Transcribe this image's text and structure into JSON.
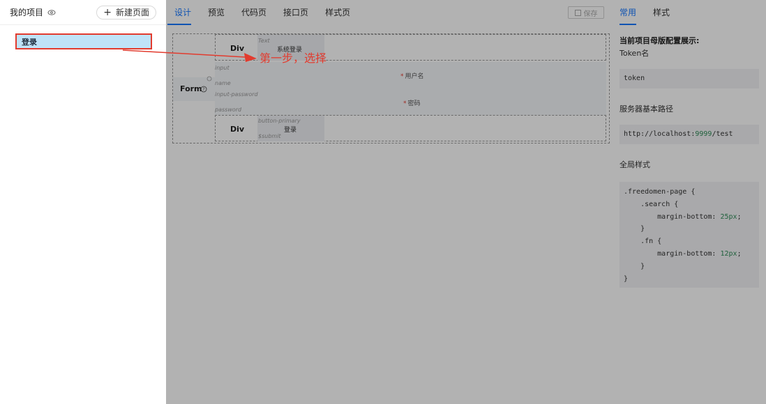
{
  "sidebar": {
    "title": "我的项目",
    "new_page_label": "新建页面",
    "pages": [
      {
        "label": "登录"
      }
    ]
  },
  "main": {
    "tabs": [
      {
        "label": "设计",
        "active": true
      },
      {
        "label": "预览"
      },
      {
        "label": "代码页"
      },
      {
        "label": "接口页"
      },
      {
        "label": "样式页"
      }
    ],
    "save_label": "保存",
    "canvas": {
      "div1_label": "Div",
      "text_hint": "Text",
      "title_text": "系统登录",
      "form_label": "Form",
      "input_hint": "input",
      "name_hint": "name",
      "username_label": "用户名",
      "password_hint": "input-password",
      "password_name_hint": "password",
      "password_label": "密码",
      "div2_label": "Div",
      "button_hint": "button-primary",
      "button_text": "登录",
      "submit_hint": "$submit"
    }
  },
  "right_panel": {
    "tabs": [
      {
        "label": "常用",
        "active": true
      },
      {
        "label": "样式"
      }
    ],
    "heading": "当前项目母版配置展示:",
    "token_label": "Token名",
    "token_value": "token",
    "base_path_label": "服务器基本路径",
    "base_path_prefix": "http://localhost:",
    "base_path_port": "9999",
    "base_path_suffix": "/test",
    "global_style_label": "全局样式",
    "css_lines": [
      ".freedomen-page {",
      "    .search {",
      "        margin-bottom: ",
      "    }",
      "    .fn {",
      "        margin-bottom: ",
      "    }",
      "}"
    ],
    "css_values": [
      "25px",
      "12px"
    ]
  },
  "annotation": {
    "text": "第一步，选择",
    "color": "#e23b2e"
  },
  "colors": {
    "accent": "#1677ff",
    "selected_bg": "#bfe3f8",
    "annotation_red": "#e23b2e"
  }
}
